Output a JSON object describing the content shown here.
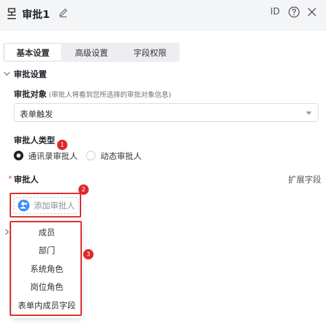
{
  "header": {
    "title": "审批1",
    "id_label": "ID",
    "icons": [
      "approval-node-icon",
      "edit-pencil-icon",
      "help-circle-icon",
      "close-icon"
    ]
  },
  "tabs": [
    {
      "label": "基本设置",
      "active": true
    },
    {
      "label": "高级设置",
      "active": false
    },
    {
      "label": "字段权限",
      "active": false
    }
  ],
  "section": {
    "title": "审批设置"
  },
  "approval_target": {
    "label": "审批对象",
    "hint": "(审批人将看到您所选择的审批对象信息)",
    "selected": "表单触发"
  },
  "approver_type": {
    "label": "审批人类型",
    "options": [
      {
        "label": "通讯录审批人",
        "checked": true
      },
      {
        "label": "动态审批人",
        "checked": false
      }
    ]
  },
  "approver": {
    "required_mark": "*",
    "label": "审批人",
    "extend_link": "扩展字段",
    "add_button": "添加审批人"
  },
  "dropdown": {
    "items": [
      "成员",
      "部门",
      "系统角色",
      "岗位角色",
      "表单内成员字段"
    ]
  },
  "annotations": [
    "1",
    "2",
    "3"
  ],
  "colors": {
    "highlight": "#e02828",
    "avatar_blue": "#3e8ef7",
    "required_red": "#e54545"
  }
}
